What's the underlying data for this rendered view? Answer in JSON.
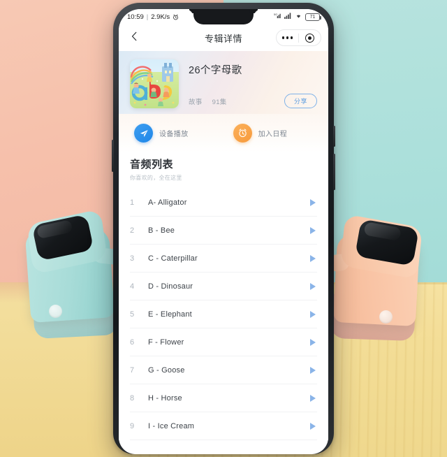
{
  "status_bar": {
    "time": "10:59",
    "separator": "|",
    "network_speed": "2.9K/s",
    "alarm_icon": "alarm-clock-icon",
    "signal_icon": "signal-icon",
    "signal_icon_2": "signal-bars-icon",
    "wifi_icon": "wifi-icon",
    "battery_level": "71"
  },
  "nav": {
    "back_icon": "back-chevron-icon",
    "title": "专辑详情",
    "more_icon": "more-dots-icon",
    "target_icon": "target-circle-icon"
  },
  "album": {
    "cover_alt": "album-cover-art",
    "title": "26个字母歌",
    "category": "故事",
    "episode_count": "91集",
    "share_label": "分享"
  },
  "actions": [
    {
      "label": "设备播放",
      "icon": "paper-plane-icon",
      "color": "#2686e8"
    },
    {
      "label": "加入日程",
      "icon": "alarm-clock-icon",
      "color": "#f79a3c"
    }
  ],
  "section": {
    "title": "音频列表",
    "subtitle": "你喜欢的，全在这里"
  },
  "tracks": [
    {
      "num": "1",
      "title": "A- Alligator"
    },
    {
      "num": "2",
      "title": "B - Bee"
    },
    {
      "num": "3",
      "title": "C - Caterpillar"
    },
    {
      "num": "4",
      "title": "D - Dinosaur"
    },
    {
      "num": "5",
      "title": "E - Elephant"
    },
    {
      "num": "6",
      "title": "F - Flower"
    },
    {
      "num": "7",
      "title": "G - Goose"
    },
    {
      "num": "8",
      "title": "H - Horse"
    },
    {
      "num": "9",
      "title": "I - Ice Cream"
    }
  ],
  "scene": {
    "left_speaker": "mint-smart-speaker",
    "right_speaker": "peach-smart-speaker",
    "wall_left_color": "#f4c0aa",
    "wall_right_color": "#ace0db",
    "table_color": "#f3dd96"
  }
}
